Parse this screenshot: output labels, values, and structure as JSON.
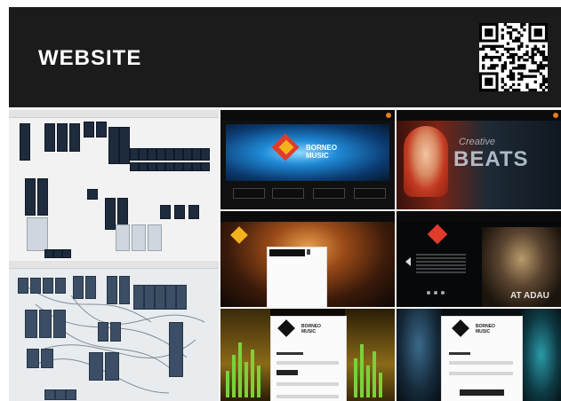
{
  "banner": {
    "title": "WEBSITE",
    "qr_icon": "qr-code-icon"
  },
  "panels": {
    "hero": {
      "brand_line1": "BORNEO",
      "brand_line2": "MUSIC",
      "buttons": [
        "",
        "",
        "",
        ""
      ]
    },
    "beats": {
      "word1": "Creative",
      "word2": "BEATS"
    },
    "event": {
      "tag": "AT ADAU"
    },
    "login": {
      "brand_line1": "BORNEO",
      "brand_line2": "MUSIC"
    },
    "register": {
      "brand_line1": "BORNEO",
      "brand_line2": "MUSIC"
    }
  },
  "colors": {
    "banner_bg": "#1b1b1b",
    "hero_accent": "#1f8ad6",
    "beats_accent": "#c23a21",
    "eq_green": "#7bd13a",
    "logo_colors": [
      "#e03b2b",
      "#f2b21b",
      "#2aa9e0",
      "#7bc043"
    ]
  }
}
